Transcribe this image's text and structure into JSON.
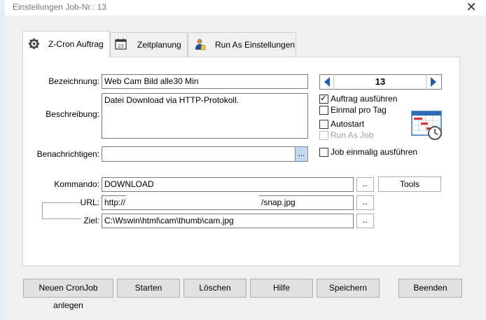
{
  "window": {
    "title": "Einstellungen Job-Nr.: 13",
    "close_glyph": "✕"
  },
  "tabs": [
    {
      "label": "Z-Cron Auftrag",
      "icon": "gear-icon",
      "active": true
    },
    {
      "label": "Zeitplanung",
      "icon": "calendar-icon",
      "active": false
    },
    {
      "label": "Run As Einstellungen",
      "icon": "user-icon",
      "active": false
    }
  ],
  "form": {
    "bezeichnung_label": "Bezeichnung:",
    "bezeichnung_value": "Web Cam Bild alle30 Min",
    "beschreibung_label": "Beschreibung:",
    "beschreibung_value": "Datei Download via HTTP-Protokoll.",
    "benachrichtigen_label": "Benachrichtigen:",
    "benachrichtigen_value": "",
    "benachrichtigen_btn": "...",
    "kommando_label": "Kommando:",
    "kommando_value": "DOWNLOAD",
    "kommando_btn": "..",
    "tools_label": "Tools",
    "url_label": "URL:",
    "url_value_start": "http://",
    "url_value_end": "/snap.jpg",
    "url_btn": "..",
    "ziel_label": "Ziel:",
    "ziel_value": "C:\\Wswin\\html\\cam\\thumb\\cam.jpg",
    "ziel_btn": ".."
  },
  "job_number": {
    "value": "13"
  },
  "options": [
    {
      "label": "Auftrag ausführen",
      "checked": true,
      "disabled": false
    },
    {
      "label": "Einmal pro Tag",
      "checked": false,
      "disabled": false
    },
    {
      "label": "Autostart",
      "checked": false,
      "disabled": false
    },
    {
      "label": "Run As Job",
      "checked": false,
      "disabled": true
    },
    {
      "label": "Job einmalig ausführen",
      "checked": false,
      "disabled": false
    }
  ],
  "buttons": {
    "new": "Neuen CronJob anlegen",
    "start": "Starten",
    "delete": "Löschen",
    "help": "Hilfe",
    "save": "Speichern",
    "exit": "Beenden"
  },
  "colors": {
    "arrow": "#1f5fa8",
    "schedule_icon": "#2e6db5",
    "schedule_red": "#d9302c"
  }
}
